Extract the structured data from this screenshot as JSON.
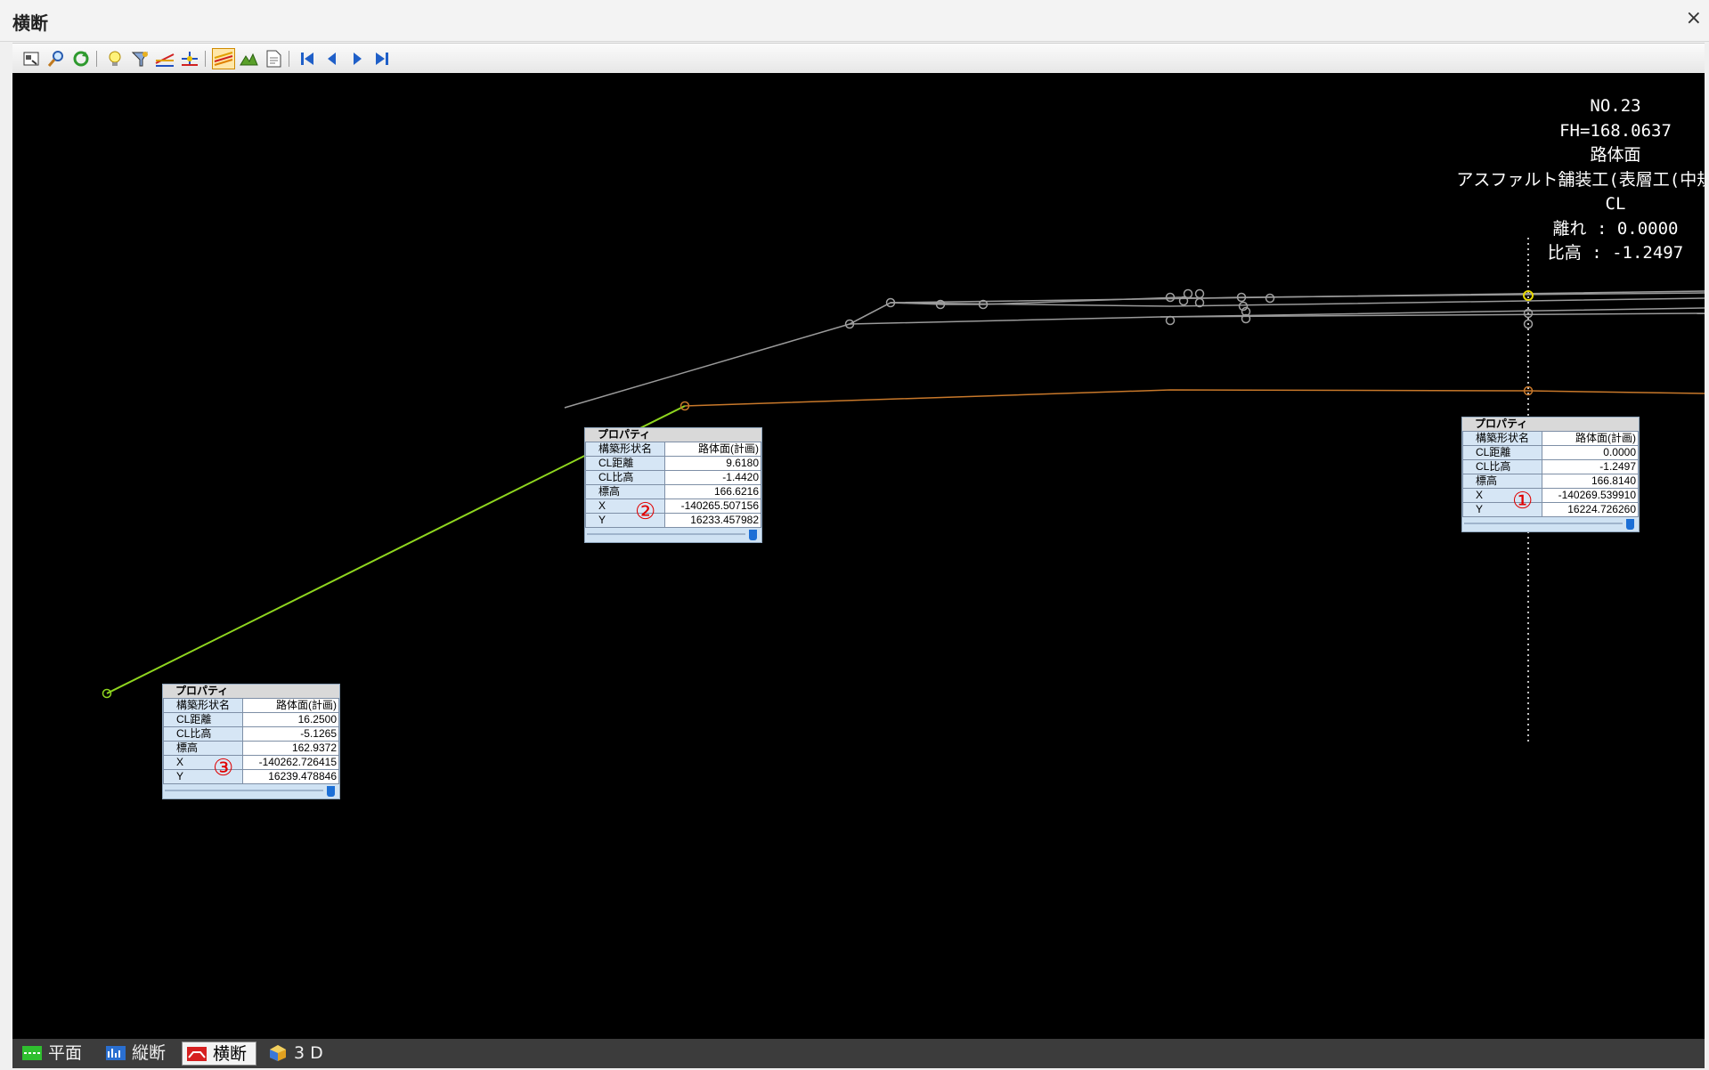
{
  "window": {
    "title": "横断",
    "close_label": "×"
  },
  "toolbar": {
    "buttons": [
      "print-preview",
      "zoom",
      "refresh",
      "hint",
      "select-filter",
      "measure-line",
      "point-edit",
      "layer",
      "terrain",
      "report",
      "first",
      "previous",
      "next",
      "last"
    ],
    "active": "layer"
  },
  "info": {
    "station": "NO.23",
    "fh": "FH=168.0637",
    "layer": "路体面",
    "work": "アスファルト舗装工(表層工(中規模以上)",
    "cl": "CL",
    "offset": "離れ : 0.0000",
    "height": "比高 : -1.2497"
  },
  "prop_labels": {
    "title": "プロパティ",
    "shape": "構築形状名",
    "cl_dist": "CL距離",
    "cl_height": "CL比高",
    "elevation": "標高",
    "x": "X",
    "y": "Y"
  },
  "props": [
    {
      "marker": "①",
      "shape": "路体面(計画)",
      "cl_dist": "0.0000",
      "cl_height": "-1.2497",
      "elevation": "166.8140",
      "x": "-140269.539910",
      "y": "16224.726260"
    },
    {
      "marker": "②",
      "shape": "路体面(計画)",
      "cl_dist": "9.6180",
      "cl_height": "-1.4420",
      "elevation": "166.6216",
      "x": "-140265.507156",
      "y": "16233.457982"
    },
    {
      "marker": "③",
      "shape": "路体面(計画)",
      "cl_dist": "16.2500",
      "cl_height": "-5.1265",
      "elevation": "162.9372",
      "x": "-140262.726415",
      "y": "16239.478846"
    }
  ],
  "tabs": [
    {
      "label": "平面",
      "color": "#2fbf2f"
    },
    {
      "label": "縦断",
      "color": "#2a6fd1"
    },
    {
      "label": "横断",
      "color": "#d62020"
    },
    {
      "label": "3 D",
      "color": "#e0a020"
    }
  ],
  "active_tab": "横断",
  "colors": {
    "slope_line": "#8fd61f",
    "subgrade_line": "#c8782a",
    "surface_lines": "#9a9a9a",
    "centerline": "#ffffff",
    "cl_point": "#e8d800"
  }
}
